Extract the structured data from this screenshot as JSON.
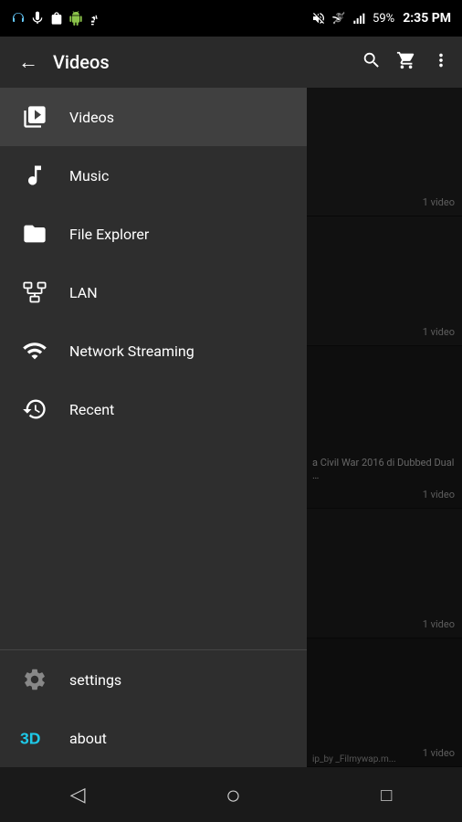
{
  "statusBar": {
    "leftIcons": [
      "headphone",
      "mic",
      "bag",
      "android",
      "usb"
    ],
    "battery": "59%",
    "time": "2:35 PM"
  },
  "topBar": {
    "backLabel": "←",
    "title": "Videos",
    "searchLabel": "search",
    "cartLabel": "cart",
    "moreLabel": "more"
  },
  "drawer": {
    "items": [
      {
        "id": "videos",
        "label": "Videos",
        "active": true
      },
      {
        "id": "music",
        "label": "Music",
        "active": false
      },
      {
        "id": "file-explorer",
        "label": "File Explorer",
        "active": false
      },
      {
        "id": "lan",
        "label": "LAN",
        "active": false
      },
      {
        "id": "network-streaming",
        "label": "Network Streaming",
        "active": false
      },
      {
        "id": "recent",
        "label": "Recent",
        "active": false
      }
    ],
    "bottomItems": [
      {
        "id": "settings",
        "label": "settings"
      },
      {
        "id": "about",
        "label": "about"
      }
    ]
  },
  "videoItems": [
    {
      "count": "1 video",
      "label": ""
    },
    {
      "count": "1 video",
      "label": ""
    },
    {
      "count": "1 video",
      "label": "a Civil War 2016 di Dubbed Dual …"
    },
    {
      "count": "1 video",
      "label": ""
    },
    {
      "count": "1 video",
      "label": ""
    }
  ],
  "filmywapLabel": "ip_by _Filmywap.m...",
  "navBar": {
    "back": "◁",
    "home": "○",
    "recent": "□"
  }
}
